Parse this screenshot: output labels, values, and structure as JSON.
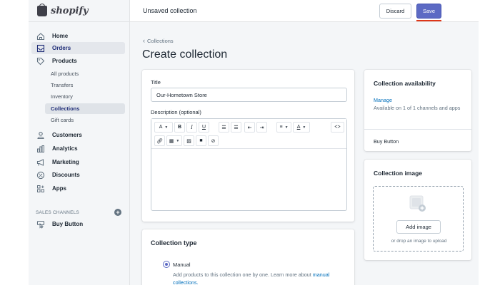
{
  "brand": {
    "name": "shopify"
  },
  "topbar": {
    "title": "Unsaved collection",
    "discard_label": "Discard",
    "save_label": "Save"
  },
  "sidebar": {
    "items": [
      {
        "label": "Home",
        "icon": "home-icon"
      },
      {
        "label": "Orders",
        "icon": "orders-icon"
      },
      {
        "label": "Products",
        "icon": "tag-icon"
      }
    ],
    "product_subitems": [
      "All products",
      "Transfers",
      "Inventory",
      "Collections",
      "Gift cards"
    ],
    "more_items": [
      {
        "label": "Customers",
        "icon": "person-icon"
      },
      {
        "label": "Analytics",
        "icon": "bar-chart-icon"
      },
      {
        "label": "Marketing",
        "icon": "megaphone-icon"
      },
      {
        "label": "Discounts",
        "icon": "discount-icon"
      },
      {
        "label": "Apps",
        "icon": "apps-icon"
      }
    ],
    "sales_channels_label": "SALES CHANNELS",
    "channel": {
      "label": "Buy Button",
      "icon": "buy-button-icon"
    }
  },
  "breadcrumb": {
    "label": "Collections"
  },
  "page": {
    "title": "Create collection"
  },
  "form": {
    "title_label": "Title",
    "title_value": "Our-Hometown Store",
    "description_label": "Description (optional)",
    "toolbar": {
      "font": "A",
      "bold": "B",
      "italic": "I",
      "underline": "U",
      "code": "<>"
    }
  },
  "collection_type": {
    "title": "Collection type",
    "manual_label": "Manual",
    "manual_desc": "Add products to this collection one by one. Learn more about",
    "manual_link": "manual collections."
  },
  "availability": {
    "title": "Collection availability",
    "manage": "Manage",
    "desc": "Available on 1 of 1 channels and apps",
    "channel": "Buy Button"
  },
  "image_card": {
    "title": "Collection image",
    "add_label": "Add image",
    "drop_hint": "or drop an image to upload"
  },
  "colors": {
    "accent": "#5c6ac4",
    "link": "#006fbb",
    "save_underline": "#de3618"
  }
}
